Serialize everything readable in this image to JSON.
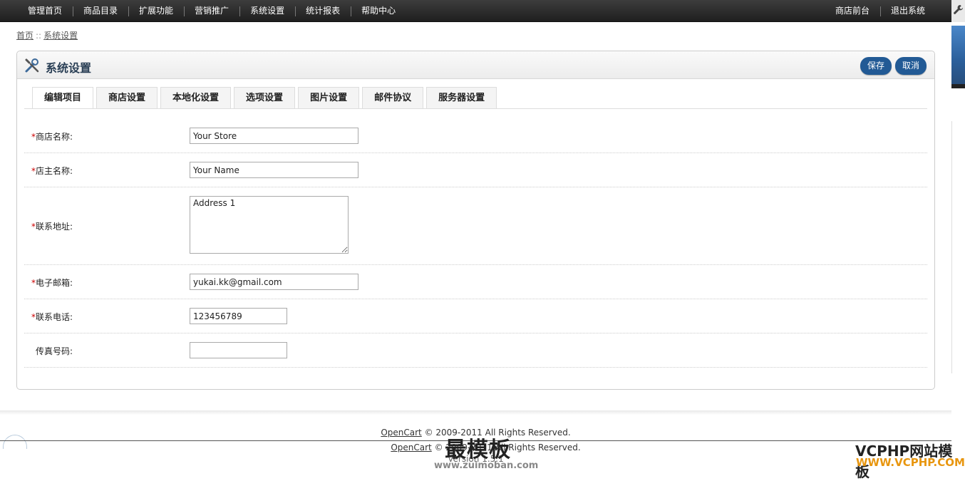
{
  "nav": {
    "left": [
      "管理首页",
      "商品目录",
      "扩展功能",
      "营销推广",
      "系统设置",
      "统计报表",
      "帮助中心"
    ],
    "right": [
      "商店前台",
      "退出系统"
    ]
  },
  "breadcrumb": {
    "home": "首页",
    "separator": "::",
    "current": "系统设置"
  },
  "panel": {
    "title": "系统设置",
    "save_label": "保存",
    "cancel_label": "取消"
  },
  "tabs": [
    "编辑项目",
    "商店设置",
    "本地化设置",
    "选项设置",
    "图片设置",
    "邮件协议",
    "服务器设置"
  ],
  "form": {
    "required_mark": "*",
    "store_name_label": "商店名称:",
    "store_name_value": "Your Store",
    "owner_label": "店主名称:",
    "owner_value": "Your Name",
    "address_label": "联系地址:",
    "address_value": "Address 1",
    "email_label": "电子邮箱:",
    "email_value": "yukai.kk@gmail.com",
    "phone_label": "联系电话:",
    "phone_value": "123456789",
    "fax_label": "传真号码:",
    "fax_value": ""
  },
  "footer": {
    "link": "OpenCart",
    "text1": " © 2009-2011 All Rights Reserved.",
    "text2": " © 2009-2011 All Rights Reserved.",
    "version": "Version 1.5.1"
  },
  "watermarks": {
    "main": "最模板",
    "sub": "www.zuimoban.com",
    "right1": "VCPHP网站模板",
    "right2": "WWW.VCPHP.COM"
  },
  "colors": {
    "nav_bg": "#2b2b2b",
    "button": "#225a95",
    "required": "#cc0000",
    "title": "#2a3f55"
  }
}
